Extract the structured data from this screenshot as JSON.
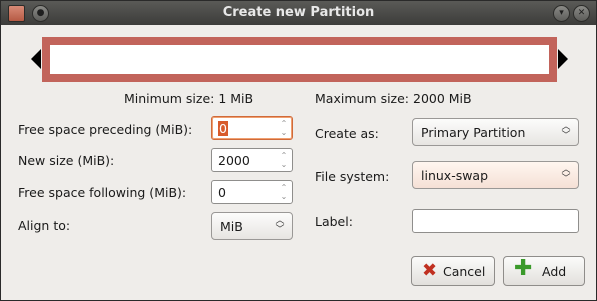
{
  "window": {
    "title": "Create new Partition"
  },
  "sizes": {
    "minimum": "Minimum size: 1 MiB",
    "maximum": "Maximum size: 2000 MiB"
  },
  "form_left": {
    "preceding_label": "Free space preceding (MiB):",
    "preceding_value": "0",
    "new_size_label": "New size (MiB):",
    "new_size_value": "2000",
    "following_label": "Free space following (MiB):",
    "following_value": "0",
    "align_label": "Align to:",
    "align_value": "MiB"
  },
  "form_right": {
    "create_as_label": "Create as:",
    "create_as_value": "Primary Partition",
    "filesystem_label": "File system:",
    "filesystem_value": "linux-swap",
    "filesystem_color": "#c2645b",
    "label_label": "Label:",
    "label_value": ""
  },
  "buttons": {
    "cancel": "Cancel",
    "add": "Add"
  },
  "icons": {
    "cancel": "cancel-x-icon",
    "add": "add-plus-icon"
  }
}
